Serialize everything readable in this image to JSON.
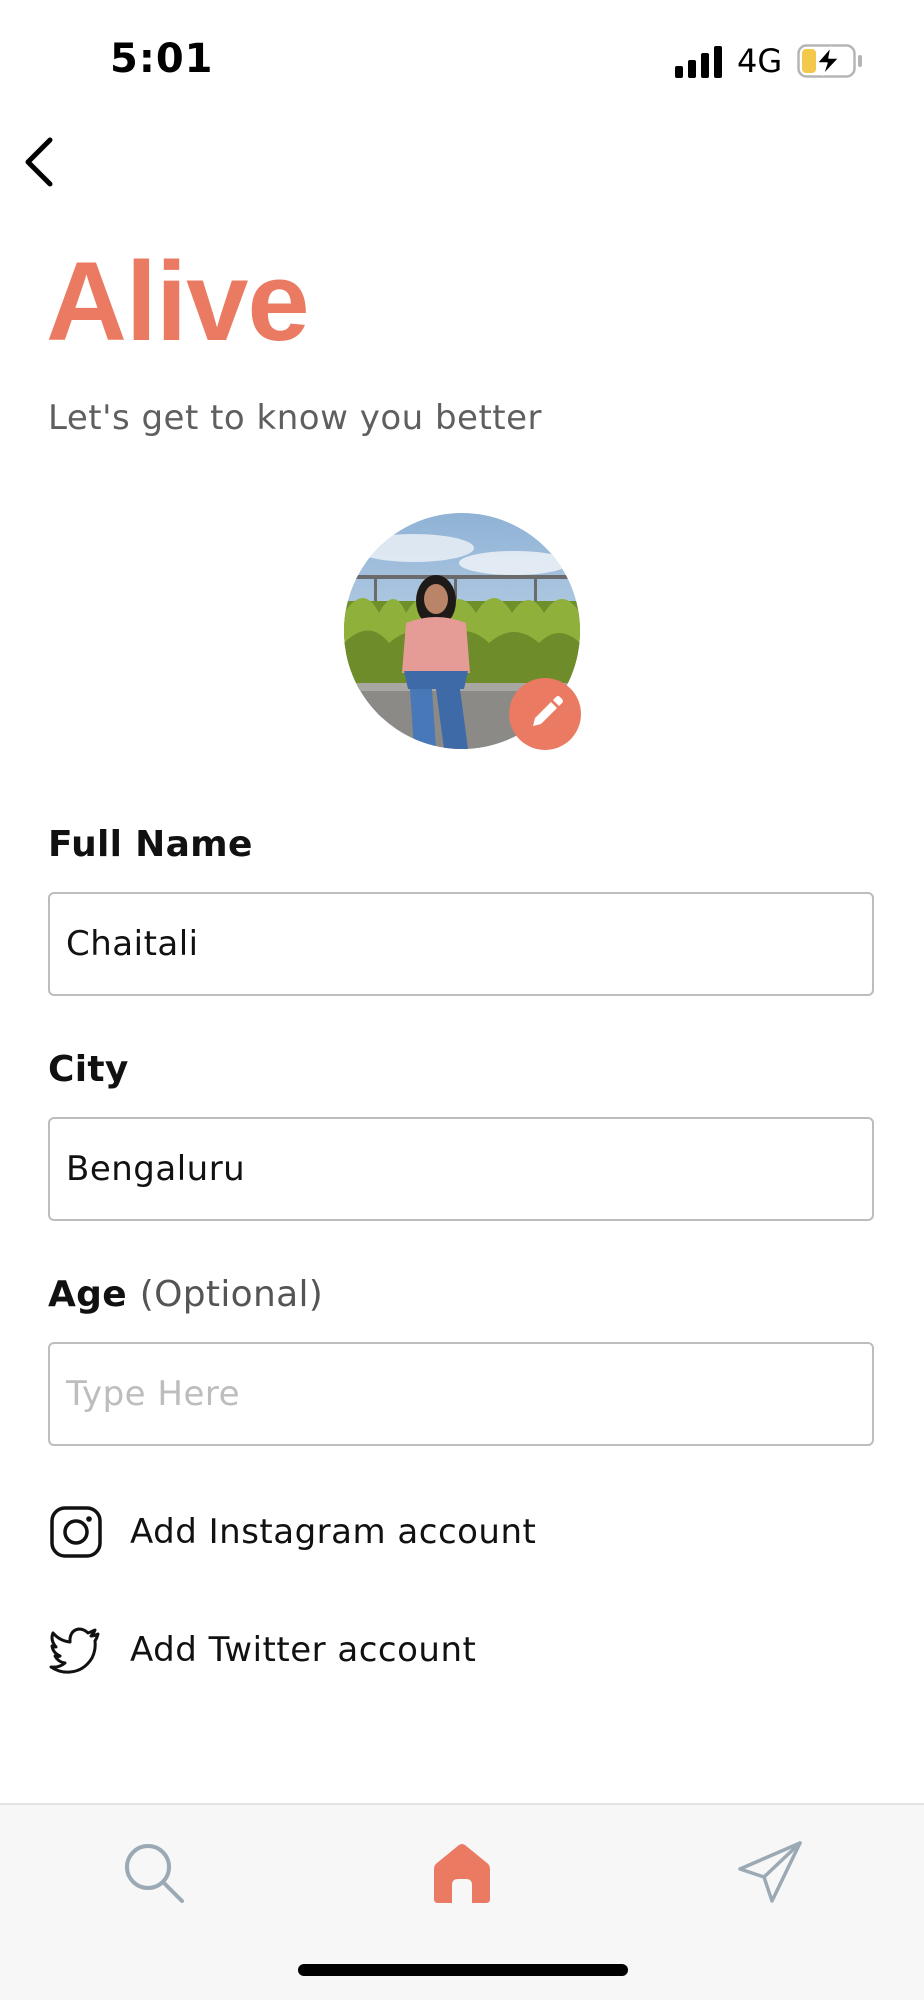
{
  "status_bar": {
    "time": "5:01",
    "network": "4G",
    "icons": [
      "signal-bars-icon",
      "battery-charging-icon"
    ]
  },
  "header": {
    "back_icon": "chevron-left-icon",
    "title": "Alive",
    "subtitle": "Let's get to know you better"
  },
  "profile": {
    "edit_icon": "pencil-icon"
  },
  "form": {
    "full_name": {
      "label": "Full Name",
      "value": "Chaitali"
    },
    "city": {
      "label": "City",
      "value": "Bengaluru"
    },
    "age": {
      "label": "Age",
      "label_suffix": "(Optional)",
      "value": "",
      "placeholder": "Type Here"
    }
  },
  "social": {
    "instagram": {
      "label": "Add Instagram account",
      "icon": "instagram-icon"
    },
    "twitter": {
      "label": "Add Twitter account",
      "icon": "twitter-icon"
    }
  },
  "bottom_nav": {
    "items": [
      {
        "icon": "search-icon",
        "active": false
      },
      {
        "icon": "home-icon",
        "active": true
      },
      {
        "icon": "send-icon",
        "active": false
      }
    ]
  },
  "colors": {
    "accent": "#EB7A62",
    "inactive_icon": "#9aa9b3",
    "text": "#111111",
    "muted_text": "#5f5f5f",
    "border": "#bdbdbd"
  }
}
